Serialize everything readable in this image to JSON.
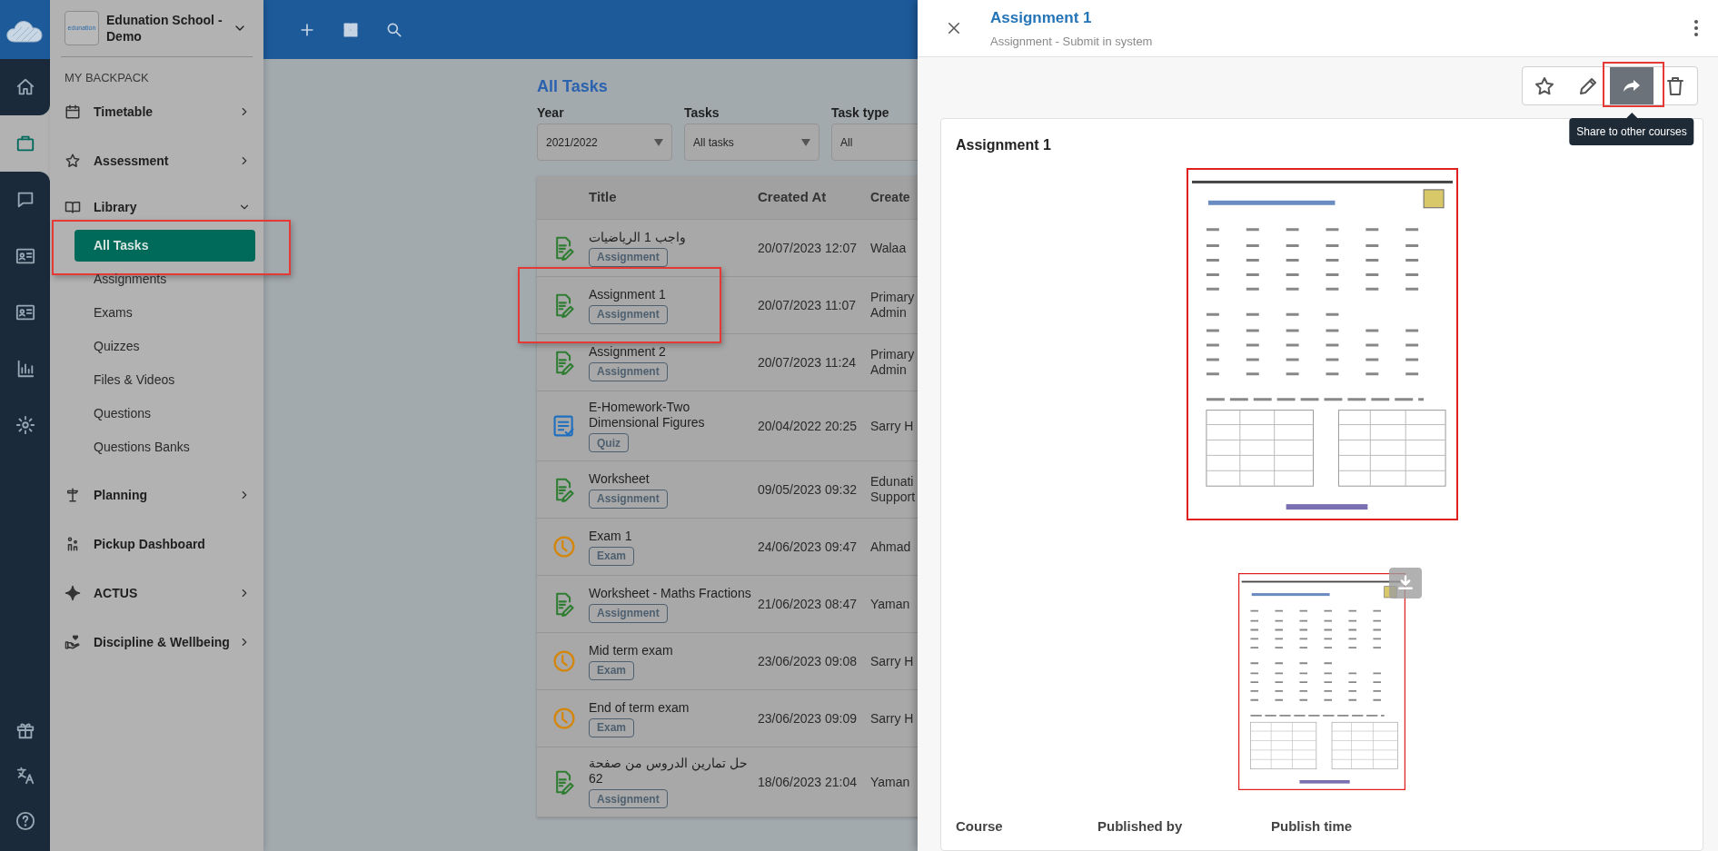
{
  "rail": {
    "items": [
      {
        "kind": "home",
        "selected": false
      },
      {
        "kind": "briefcase",
        "selected": true
      },
      {
        "kind": "chat",
        "selected": false
      },
      {
        "kind": "id-card",
        "selected": false
      },
      {
        "kind": "id-card",
        "selected": false
      },
      {
        "kind": "chart",
        "selected": false
      },
      {
        "kind": "gear",
        "selected": false
      }
    ],
    "bottom_items": [
      {
        "kind": "gift",
        "selected": false
      },
      {
        "kind": "translate",
        "selected": false
      },
      {
        "kind": "help",
        "selected": false
      }
    ]
  },
  "school": {
    "logo_text": "edunation",
    "name": "Edunation School - Demo"
  },
  "sidebar": {
    "section": "MY BACKPACK",
    "items": [
      {
        "label": "Timetable",
        "kind": "calendar",
        "expanded": false
      },
      {
        "label": "Assessment",
        "kind": "star",
        "expanded": false
      },
      {
        "label": "Library",
        "kind": "book",
        "expanded": true,
        "children": [
          {
            "label": "All Tasks",
            "selected": true,
            "highlighted": true
          },
          {
            "label": "Assignments",
            "selected": false,
            "highlighted": false
          },
          {
            "label": "Exams",
            "selected": false,
            "highlighted": false
          },
          {
            "label": "Quizzes",
            "selected": false,
            "highlighted": false
          },
          {
            "label": "Files & Videos",
            "selected": false,
            "highlighted": false
          },
          {
            "label": "Questions",
            "selected": false,
            "highlighted": false
          },
          {
            "label": "Questions Banks",
            "selected": false,
            "highlighted": false
          }
        ]
      },
      {
        "label": "Planning",
        "kind": "signpost",
        "expanded": false
      },
      {
        "label": "Pickup Dashboard",
        "kind": "people"
      },
      {
        "label": "ACTUS",
        "kind": "sparkle",
        "expanded": false
      },
      {
        "label": "Discipline & Wellbeing",
        "kind": "heart-hand",
        "expanded": false
      }
    ]
  },
  "main": {
    "title": "All Tasks",
    "filters": [
      {
        "label": "Year",
        "value": "2021/2022",
        "caret": true
      },
      {
        "label": "Tasks",
        "value": "All tasks",
        "caret": true
      },
      {
        "label": "Task type",
        "value": "All",
        "caret": false
      }
    ],
    "table": {
      "columns": [
        "Title",
        "Created At",
        "Create"
      ],
      "rows": [
        {
          "kind": "assignment",
          "title": "واجب 1 الرياضيات",
          "type": "Assignment",
          "created_at": "20/07/2023 12:07",
          "created_by": [
            "Walaa"
          ],
          "highlighted": false
        },
        {
          "kind": "assignment",
          "title": "Assignment 1",
          "type": "Assignment",
          "created_at": "20/07/2023 11:07",
          "created_by": [
            "Primary",
            "Admin"
          ],
          "highlighted": true
        },
        {
          "kind": "assignment",
          "title": "Assignment 2",
          "type": "Assignment",
          "created_at": "20/07/2023 11:24",
          "created_by": [
            "Primary",
            "Admin"
          ],
          "highlighted": false
        },
        {
          "kind": "quiz",
          "title": "E-Homework-Two Dimensional Figures",
          "type": "Quiz",
          "created_at": "20/04/2022 20:25",
          "created_by": [
            "Sarry H"
          ],
          "highlighted": false
        },
        {
          "kind": "assignment",
          "title": "Worksheet",
          "type": "Assignment",
          "created_at": "09/05/2023 09:32",
          "created_by": [
            "Edunati",
            "Support"
          ],
          "highlighted": false
        },
        {
          "kind": "exam",
          "title": "Exam 1",
          "type": "Exam",
          "created_at": "24/06/2023 09:47",
          "created_by": [
            "Ahmad"
          ],
          "highlighted": false
        },
        {
          "kind": "assignment",
          "title": "Worksheet - Maths Fractions",
          "type": "Assignment",
          "created_at": "21/06/2023 08:47",
          "created_by": [
            "Yaman"
          ],
          "highlighted": false
        },
        {
          "kind": "exam",
          "title": "Mid term exam",
          "type": "Exam",
          "created_at": "23/06/2023 09:08",
          "created_by": [
            "Sarry H"
          ],
          "highlighted": false
        },
        {
          "kind": "exam",
          "title": "End of term exam",
          "type": "Exam",
          "created_at": "23/06/2023 09:09",
          "created_by": [
            "Sarry H"
          ],
          "highlighted": false
        },
        {
          "kind": "assignment",
          "title": "حل تمارين الدروس من صفحة 62",
          "type": "Assignment",
          "created_at": "18/06/2023 21:04",
          "created_by": [
            "Yaman"
          ],
          "highlighted": false
        }
      ]
    }
  },
  "panel": {
    "title": "Assignment 1",
    "subtitle": "Assignment - Submit in system",
    "actions": [
      {
        "kind": "star",
        "selected": false,
        "highlighted": false
      },
      {
        "kind": "edit",
        "selected": false,
        "highlighted": false
      },
      {
        "kind": "share",
        "selected": true,
        "highlighted": true,
        "tooltip": "Share to other courses"
      },
      {
        "kind": "delete",
        "selected": false,
        "highlighted": false
      }
    ],
    "card_title": "Assignment 1",
    "attachments": [
      {
        "kind": "picture",
        "download": false
      },
      {
        "kind": "picture",
        "download": true
      }
    ],
    "details": [
      "Course",
      "Published by",
      "Publish time"
    ]
  }
}
